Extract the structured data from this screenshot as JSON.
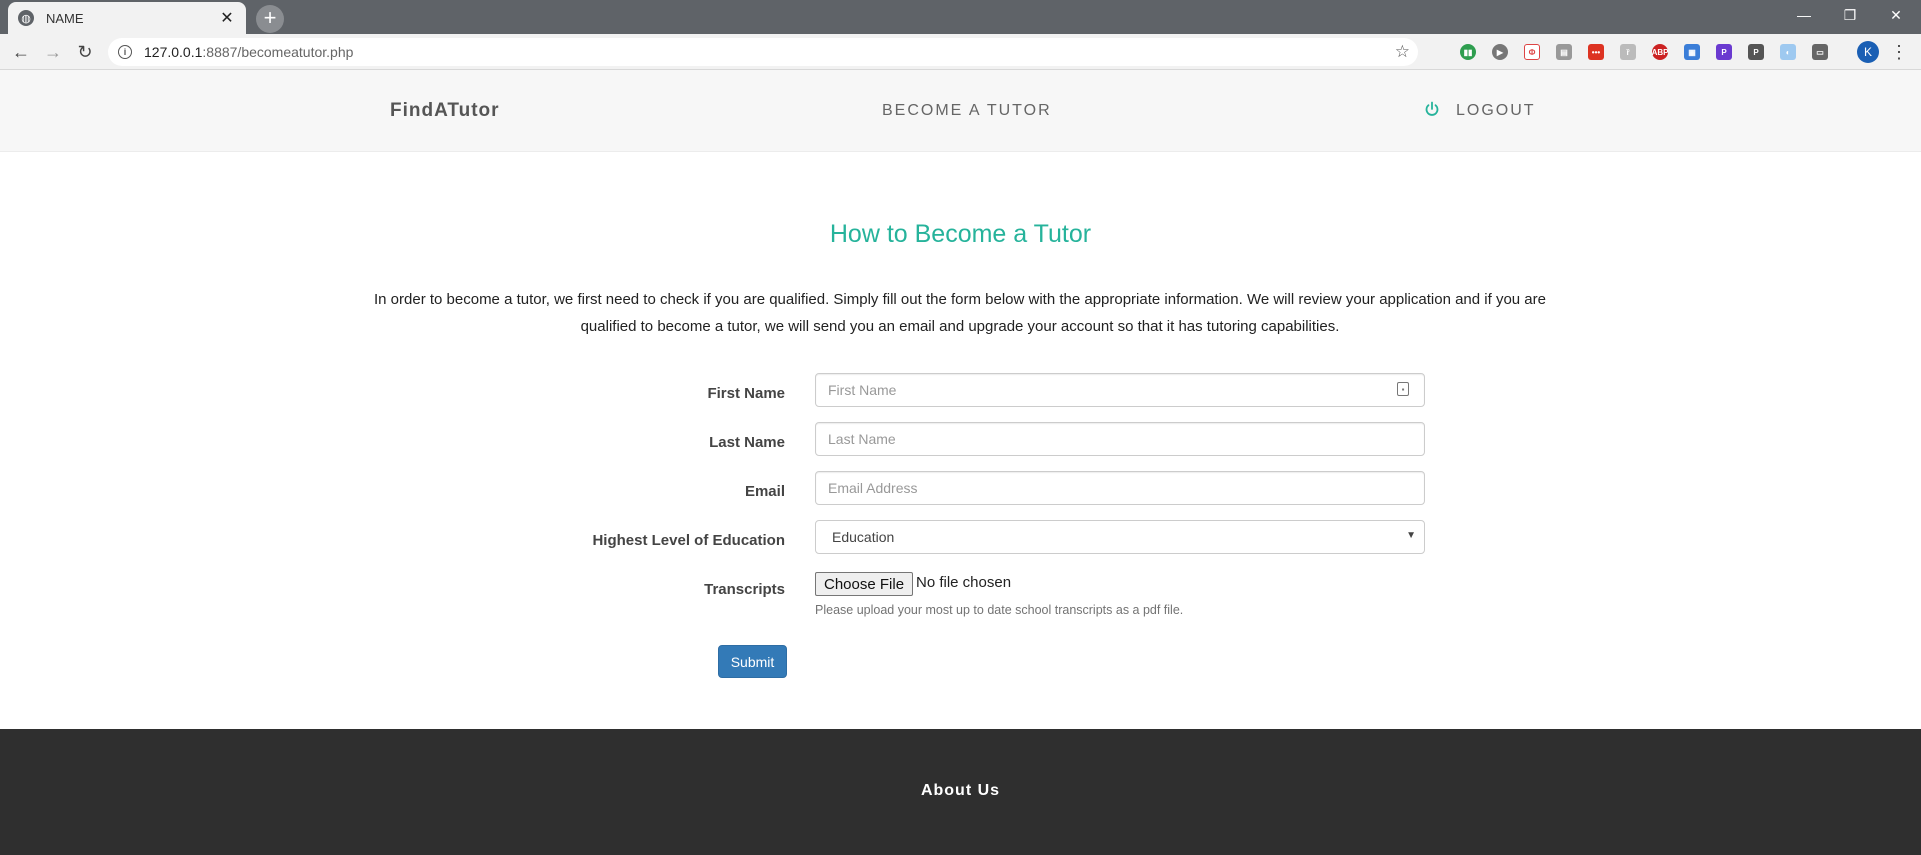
{
  "browser": {
    "tab_title": "NAME",
    "tab_close": "✕",
    "new_tab": "+",
    "url_host": "127.0.0.1",
    "url_path": ":8887/becomeatutor.php",
    "profile_initial": "K",
    "window": {
      "minimize": "—",
      "restore": "❐",
      "close": "✕"
    }
  },
  "nav": {
    "brand": "FindATutor",
    "become_tutor": "BECOME A TUTOR",
    "logout": "LOGOUT",
    "accent_color": "#26b39b"
  },
  "main": {
    "heading": "How to Become a Tutor",
    "intro": "In order to become a tutor, we first need to check if you are qualified. Simply fill out the form below with the appropriate information. We will review your application and if you are qualified to become a tutor, we will send you an email and upgrade your account so that it has tutoring capabilities."
  },
  "form": {
    "first_name_label": "First Name",
    "first_name_placeholder": "First Name",
    "last_name_label": "Last Name",
    "last_name_placeholder": "Last Name",
    "email_label": "Email",
    "email_placeholder": "Email Address",
    "education_label": "Highest Level of Education",
    "education_selected": "Education",
    "transcripts_label": "Transcripts",
    "choose_file": "Choose File",
    "file_status": "No file chosen",
    "help_text": "Please upload your most up to date school transcripts as a pdf file.",
    "submit": "Submit"
  },
  "footer": {
    "title": "About Us"
  }
}
